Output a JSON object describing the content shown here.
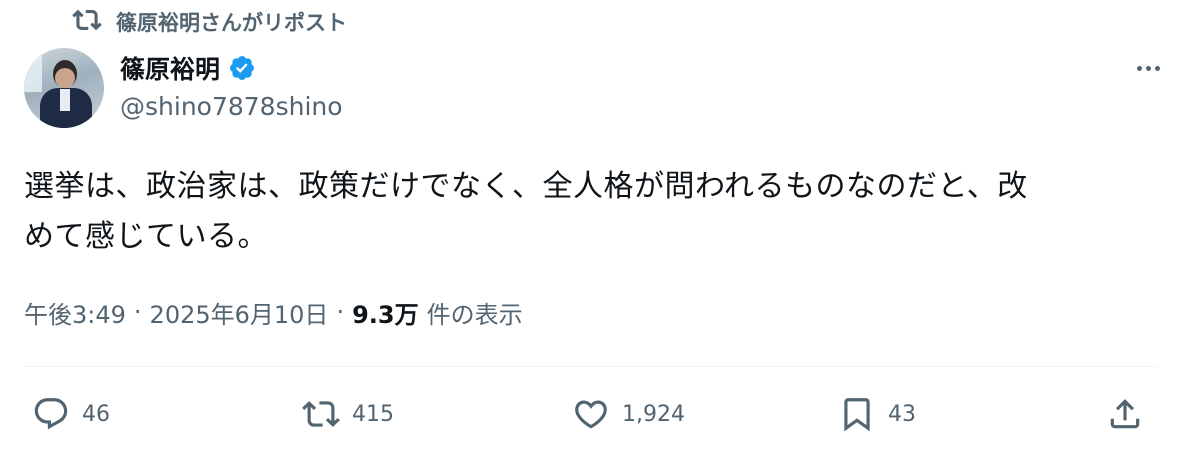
{
  "repost": {
    "label": "篠原裕明さんがリポスト",
    "icon": "repost-icon"
  },
  "author": {
    "display_name": "篠原裕明",
    "handle": "@shino7878shino",
    "verified": true,
    "verified_color": "#1d9bf0"
  },
  "tweet": {
    "lines": [
      "選挙は、政治家は、政策だけでなく、全人格が問われるものなのだと、改",
      "めて感じている。"
    ]
  },
  "meta": {
    "time": "午後3:49",
    "separator": "·",
    "date": "2025年6月10日",
    "views_count": "9.3万",
    "views_label": "件の表示"
  },
  "actions": {
    "replies": "46",
    "reposts": "415",
    "likes": "1,924",
    "bookmarks": "43"
  },
  "colors": {
    "text_primary": "#0f1419",
    "text_secondary": "#536471",
    "divider": "#eff3f4"
  }
}
